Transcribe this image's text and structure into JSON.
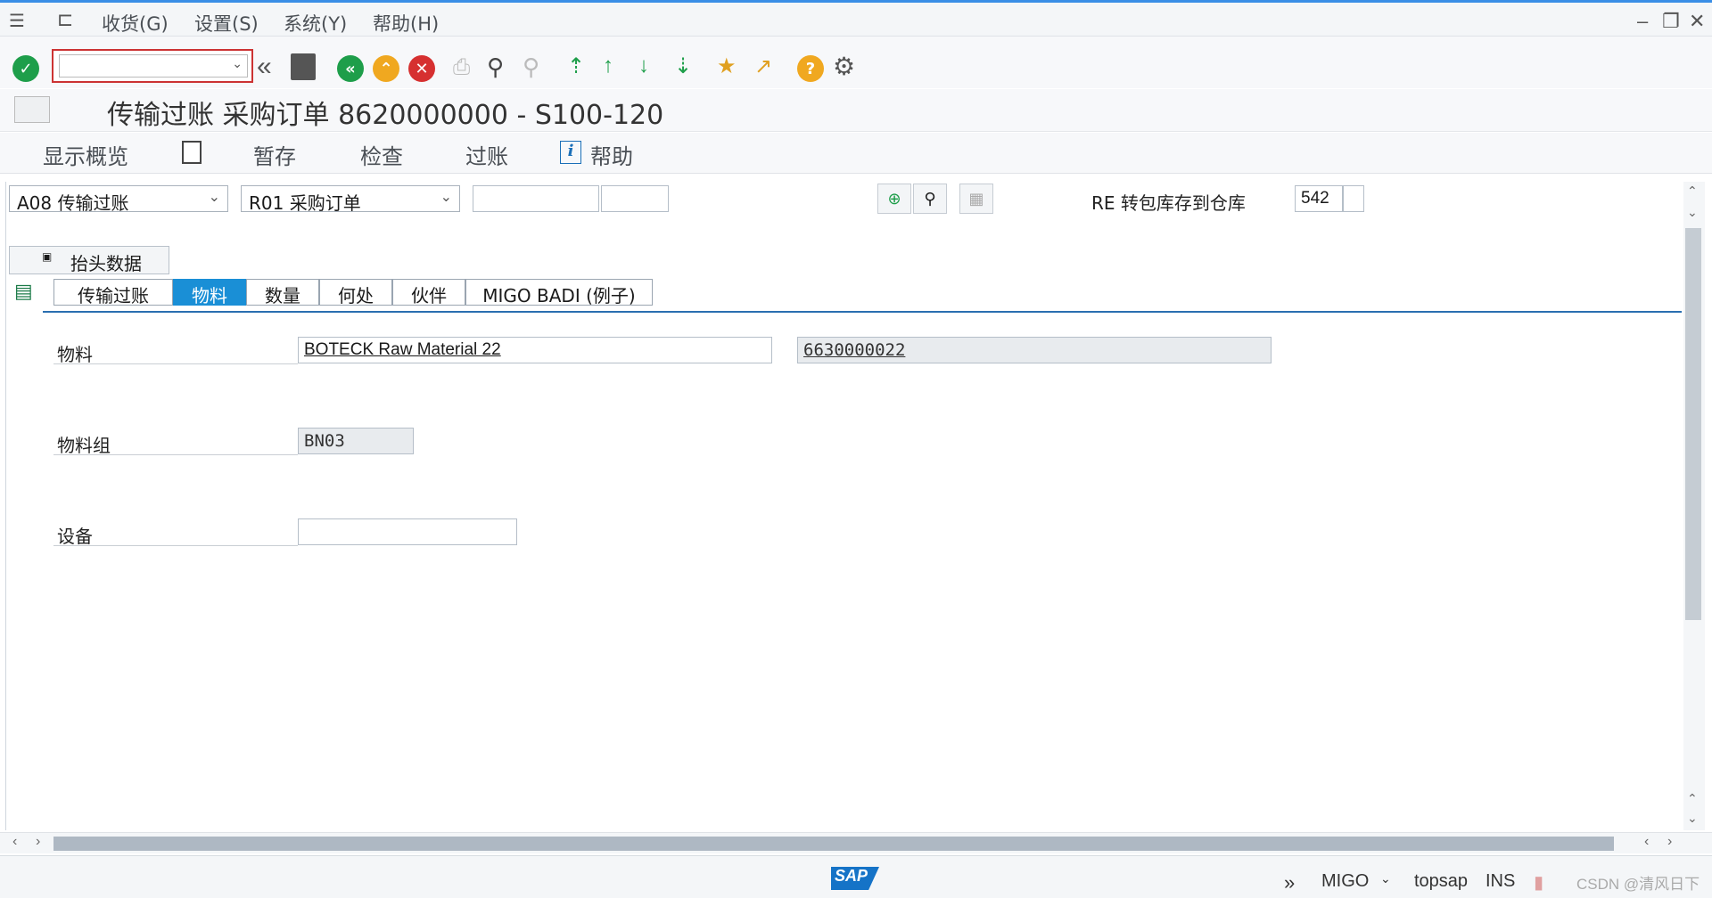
{
  "menu": {
    "items": [
      "收货(G)",
      "设置(S)",
      "系统(Y)",
      "帮助(H)"
    ]
  },
  "toolbar": {
    "command_value": "",
    "icons": [
      "check-icon",
      "back-double-icon",
      "save-icon",
      "back-icon",
      "exit-icon",
      "cancel-icon",
      "print-icon",
      "find-icon",
      "find-next-icon",
      "first-page-icon",
      "prev-page-icon",
      "next-page-icon",
      "last-page-icon",
      "new-session-icon",
      "shortcut-icon",
      "help-icon",
      "settings-icon"
    ]
  },
  "title": "传输过账 采购订单 8620000000 - S100-120",
  "app_toolbar": {
    "show_overview": "显示概览",
    "hold": "暂存",
    "check": "检查",
    "post": "过账",
    "help": "帮助"
  },
  "header_row": {
    "action": "A08 传输过账",
    "reference": "R01 采购订单",
    "doc_number": "",
    "doc_item": "",
    "movement_label": "RE 转包库存到仓库",
    "movement_type": "542"
  },
  "header_data_button": "抬头数据",
  "tabs": [
    {
      "label": "传输过账",
      "active": false
    },
    {
      "label": "物料",
      "active": true
    },
    {
      "label": "数量",
      "active": false
    },
    {
      "label": "何处",
      "active": false
    },
    {
      "label": "伙伴",
      "active": false
    },
    {
      "label": "MIGO BADI (例子)",
      "active": false
    }
  ],
  "material_tab": {
    "material_label": "物料",
    "material_desc": "BOTECK Raw Material 22",
    "material_number": "6630000022",
    "material_group_label": "物料组",
    "material_group": "BN03",
    "equipment_label": "设备",
    "equipment": ""
  },
  "status_bar": {
    "transaction": "MIGO",
    "server": "topsap",
    "mode": "INS",
    "watermark": "CSDN @清风日下"
  },
  "colors": {
    "active_tab": "#1a8fd6",
    "ok": "#1e9e4a",
    "cancel": "#d63030",
    "exit": "#f0a820",
    "sap_blue": "#1573c7"
  }
}
